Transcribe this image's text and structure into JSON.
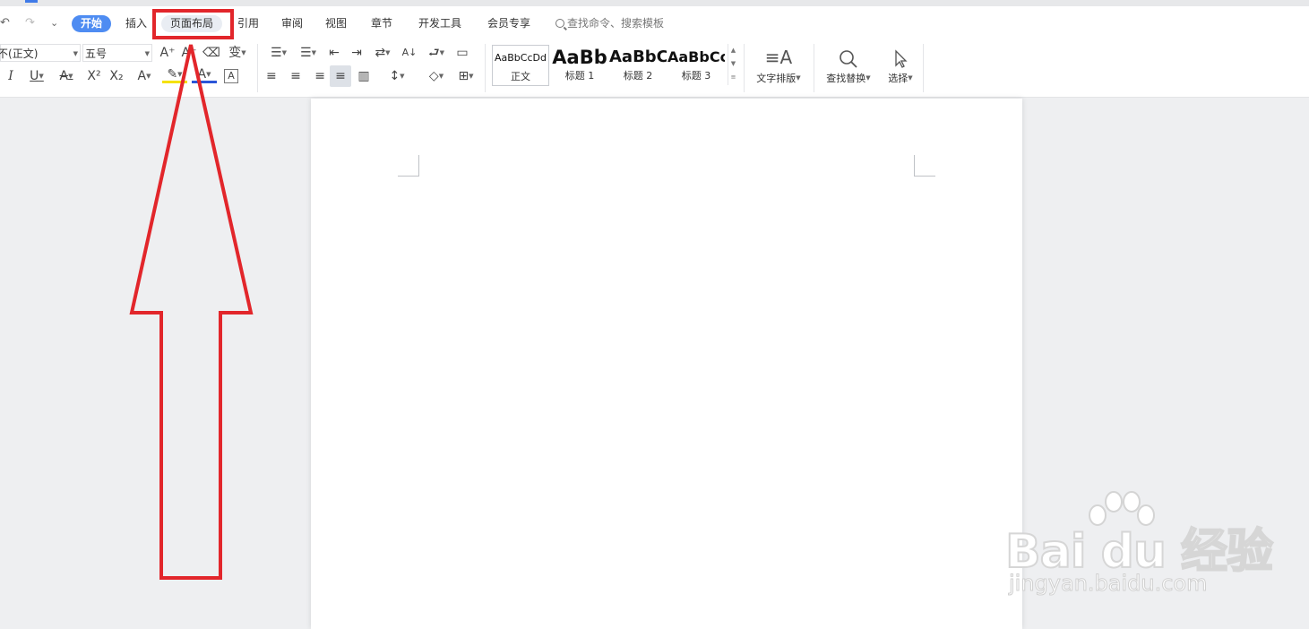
{
  "quick_access": {
    "undo": "↶",
    "redo": "↷",
    "more": "⌄"
  },
  "tabs": [
    {
      "label": "开始"
    },
    {
      "label": "插入"
    },
    {
      "label": "页面布局"
    },
    {
      "label": "引用"
    },
    {
      "label": "审阅"
    },
    {
      "label": "视图"
    },
    {
      "label": "章节"
    },
    {
      "label": "开发工具"
    },
    {
      "label": "会员专享"
    }
  ],
  "search": {
    "placeholder": "查找命令、搜索模板"
  },
  "font": {
    "family_value": "(正文)",
    "family_prefix": "不",
    "size_value": "五号"
  },
  "font_buttons": {
    "grow": "A⁺",
    "shrink": "A⁻",
    "clear": "⌫",
    "phonetic": "变",
    "italic": "I",
    "underline": "U",
    "strike": "A",
    "superscript": "X²",
    "subscript": "X₂",
    "effect": "A",
    "highlight": "✎",
    "color": "A",
    "border": "A"
  },
  "paragraph_buttons": {
    "bullets": "☰",
    "numbering": "☰",
    "outdent": "⇤",
    "indent": "⇥",
    "direction": "⇄",
    "sort": "A↓",
    "para_marks": "⮐",
    "ruler": "▭",
    "align_left": "≡",
    "align_center": "≡",
    "align_right": "≡",
    "justify": "≡",
    "distribute": "▥",
    "line_spacing": "↕",
    "shading": "◇",
    "borders": "⊞"
  },
  "styles": [
    {
      "sample": "AaBbCcDd",
      "label": "正文"
    },
    {
      "sample": "AaBb",
      "label": "标题 1"
    },
    {
      "sample": "AaBbC",
      "label": "标题 2"
    },
    {
      "sample": "AaBbCc",
      "label": "标题 3"
    }
  ],
  "big_buttons": [
    {
      "icon": "≡A",
      "label": "文字排版"
    },
    {
      "icon": "🔍",
      "label": "查找替换"
    },
    {
      "icon": "➚",
      "label": "选择"
    }
  ],
  "watermark": {
    "logo": "Bai du 经验",
    "url": "jingyan.baidu.com"
  },
  "colors": {
    "accent": "#4e8cf2",
    "annotation": "#e2262b"
  }
}
